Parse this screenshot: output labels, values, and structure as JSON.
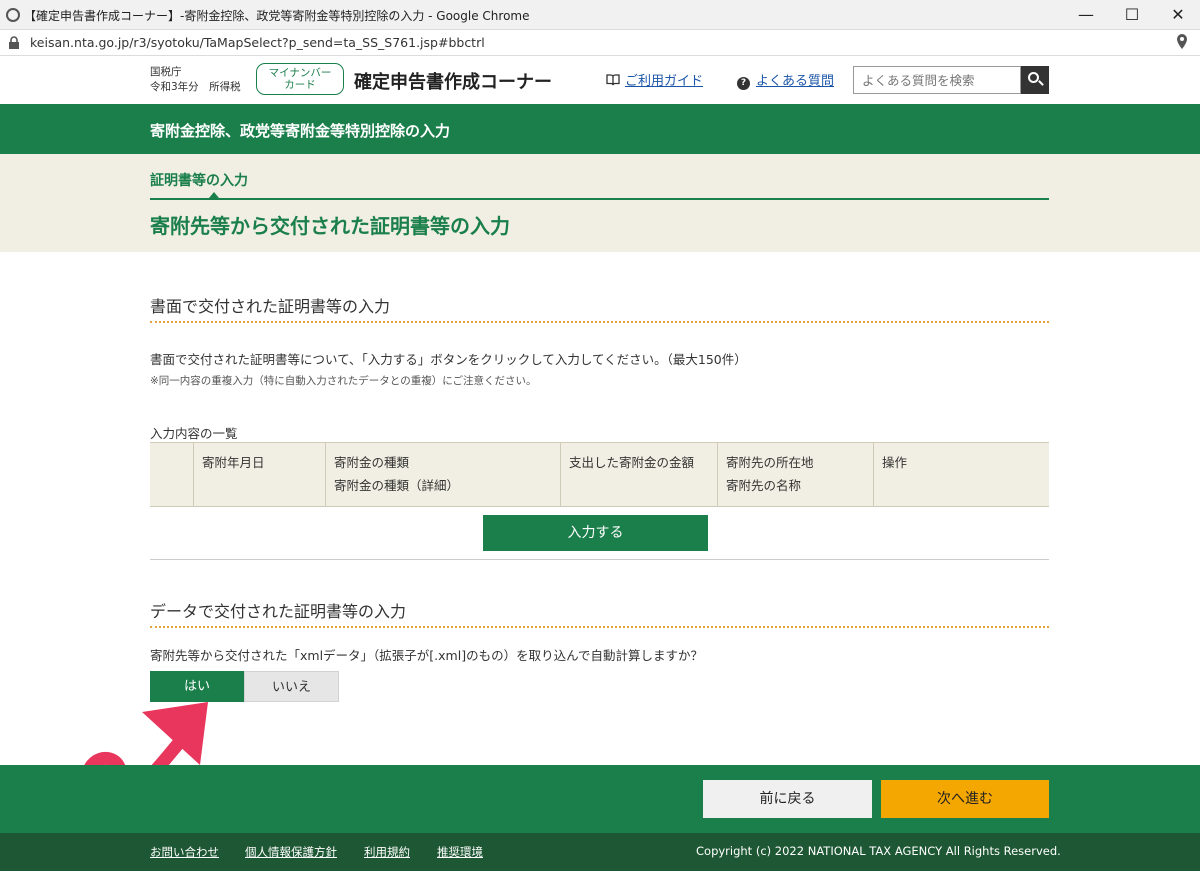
{
  "browser": {
    "tab_title": "【確定申告書作成コーナー】-寄附金控除、政党等寄附金等特別控除の入力 - Google Chrome",
    "url": "keisan.nta.go.jp/r3/syotoku/TaMapSelect?p_send=ta_SS_S761.jsp#bbctrl",
    "controls": {
      "minimize": "—",
      "maximize": "☐",
      "close": "✕"
    }
  },
  "header": {
    "org_line1": "国税庁",
    "org_line2": "令和3年分　所得税",
    "mynumber_line1": "マイナンバー",
    "mynumber_line2": "カード",
    "corner_title": "確定申告書作成コーナー",
    "guide_link": "ご利用ガイド",
    "faq_link": "よくある質問",
    "search_placeholder": "よくある質問を検索"
  },
  "banner": {
    "title": "寄附金控除、政党等寄附金等特別控除の入力"
  },
  "step": {
    "label": "証明書等の入力",
    "page_title": "寄附先等から交付された証明書等の入力"
  },
  "section_paper": {
    "heading": "書面で交付された証明書等の入力",
    "description": "書面で交付された証明書等について、「入力する」ボタンをクリックして入力してください。（最大150件）",
    "note": "※同一内容の重複入力（特に自動入力されたデータとの重複）にご注意ください。",
    "list_label": "入力内容の一覧",
    "table_headers": [
      {
        "line1": "",
        "line2": ""
      },
      {
        "line1": "寄附年月日",
        "line2": ""
      },
      {
        "line1": "寄附金の種類",
        "line2": "寄附金の種類（詳細）"
      },
      {
        "line1": "支出した寄附金の金額",
        "line2": ""
      },
      {
        "line1": "寄附先の所在地",
        "line2": "寄附先の名称"
      },
      {
        "line1": "操作",
        "line2": ""
      }
    ],
    "input_button": "入力する"
  },
  "section_data": {
    "heading": "データで交付された証明書等の入力",
    "question": "寄附先等から交付された「xmlデータ」（拡張子が[.xml]のもの）を取り込んで自動計算しますか？",
    "yes_label": "はい",
    "no_label": "いいえ"
  },
  "footer": {
    "back_button": "前に戻る",
    "next_button": "次へ進む",
    "links": [
      "お問い合わせ",
      "個人情報保護方針",
      "利用規約",
      "推奨環境"
    ],
    "copyright": "Copyright (c) 2022 NATIONAL TAX AGENCY All Rights Reserved."
  },
  "colors": {
    "primary_green": "#1a7f4b",
    "dark_green": "#1d5733",
    "accent_orange": "#f4a700",
    "annotation_red": "#e8365d"
  }
}
